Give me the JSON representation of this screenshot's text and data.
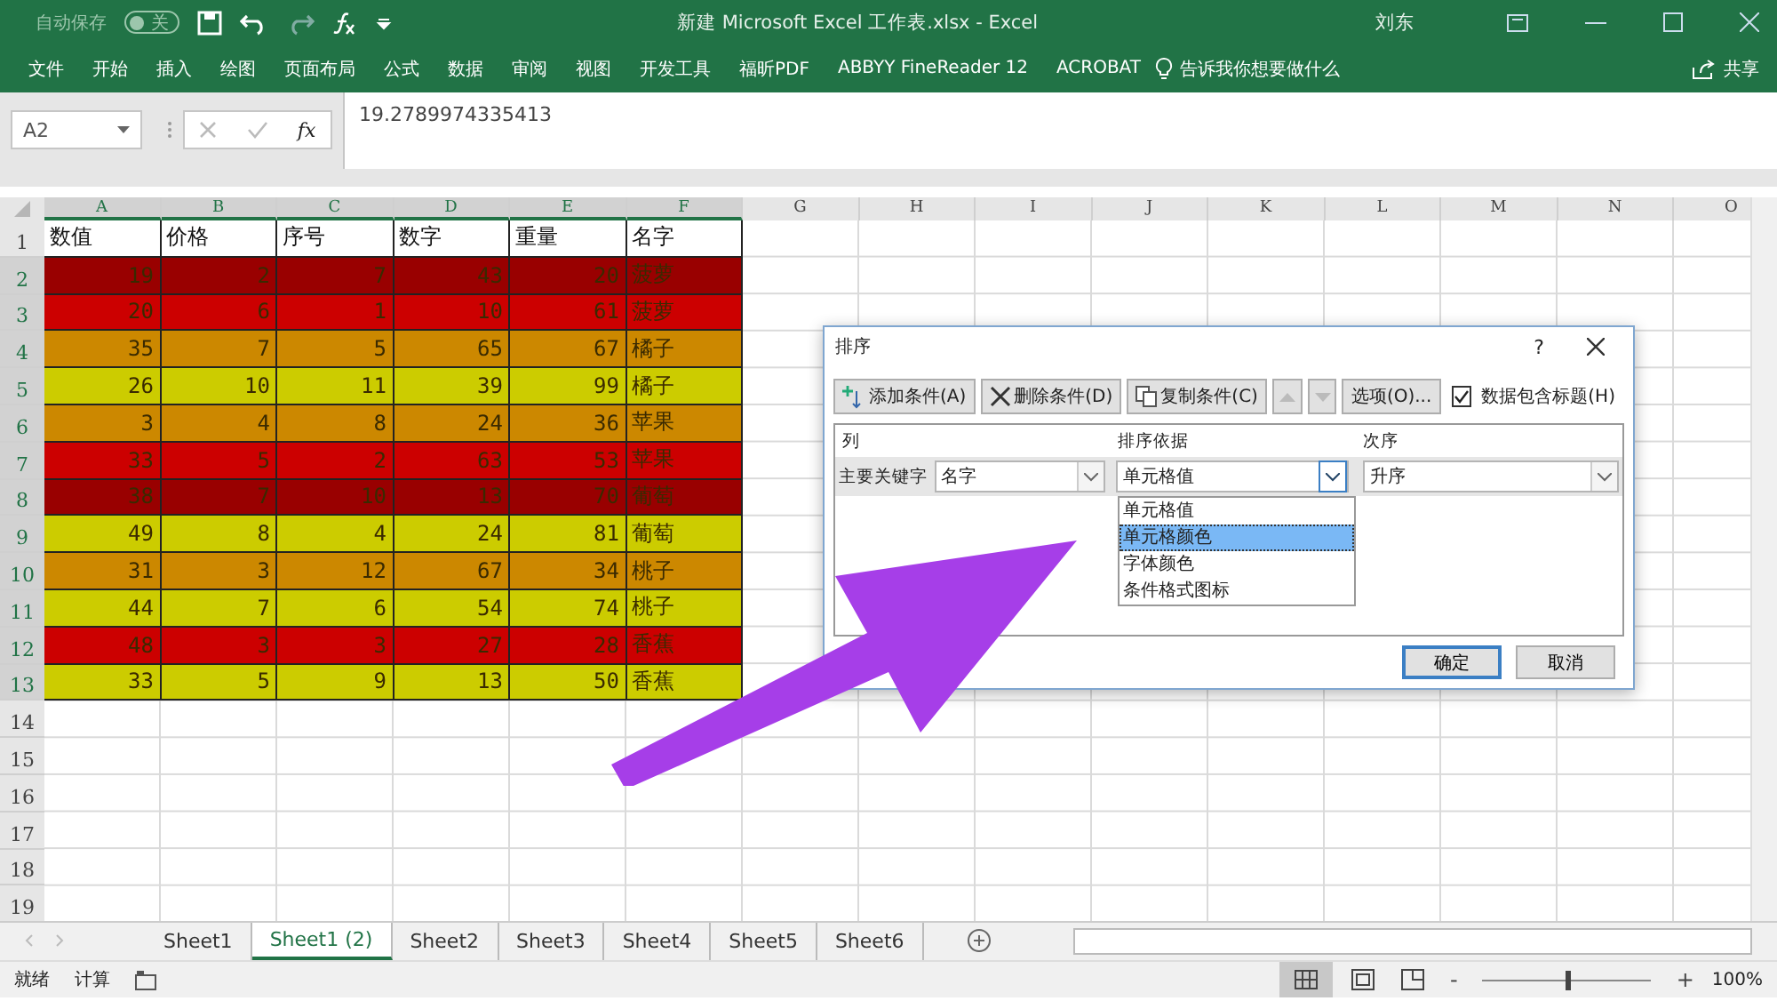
{
  "title_bar": {
    "autosave_label": "自动保存",
    "autosave_state": "关",
    "autosave_on": false,
    "title": "新建 Microsoft Excel 工作表.xlsx  -  Excel",
    "user": "刘东"
  },
  "ribbon": {
    "tabs": [
      "文件",
      "开始",
      "插入",
      "绘图",
      "页面布局",
      "公式",
      "数据",
      "审阅",
      "视图",
      "开发工具",
      "福昕PDF",
      "ABBYY FineReader 12",
      "ACROBAT"
    ],
    "tell_me": "告诉我你想要做什么",
    "share": "共享"
  },
  "formula_bar": {
    "name_box": "A2",
    "fx": "fx",
    "value": "19.2789974335413"
  },
  "sheet": {
    "columns": [
      "A",
      "B",
      "C",
      "D",
      "E",
      "F",
      "G",
      "H",
      "I",
      "J",
      "K",
      "L",
      "M",
      "N",
      "O"
    ],
    "row_numbers": [
      "1",
      "2",
      "3",
      "4",
      "5",
      "6",
      "7",
      "8",
      "9",
      "10",
      "11",
      "12",
      "13",
      "14",
      "15",
      "16",
      "17",
      "18",
      "19"
    ],
    "header": [
      "数值",
      "价格",
      "序号",
      "数字",
      "重量",
      "名字"
    ],
    "rows": [
      {
        "color": "#990000",
        "cells": [
          "19",
          "2",
          "7",
          "43",
          "20",
          "菠萝"
        ]
      },
      {
        "color": "#cc0000",
        "cells": [
          "20",
          "6",
          "1",
          "10",
          "61",
          "菠萝"
        ]
      },
      {
        "color": "#cc8800",
        "cells": [
          "35",
          "7",
          "5",
          "65",
          "67",
          "橘子"
        ]
      },
      {
        "color": "#cccc00",
        "cells": [
          "26",
          "10",
          "11",
          "39",
          "99",
          "橘子"
        ]
      },
      {
        "color": "#cc8800",
        "cells": [
          "3",
          "4",
          "8",
          "24",
          "36",
          "苹果"
        ]
      },
      {
        "color": "#cc0000",
        "cells": [
          "33",
          "5",
          "2",
          "63",
          "53",
          "苹果"
        ]
      },
      {
        "color": "#990000",
        "cells": [
          "38",
          "7",
          "10",
          "13",
          "70",
          "葡萄"
        ]
      },
      {
        "color": "#cccc00",
        "cells": [
          "49",
          "8",
          "4",
          "24",
          "81",
          "葡萄"
        ]
      },
      {
        "color": "#cc8800",
        "cells": [
          "31",
          "3",
          "12",
          "67",
          "34",
          "桃子"
        ]
      },
      {
        "color": "#cccc00",
        "cells": [
          "44",
          "7",
          "6",
          "54",
          "74",
          "桃子"
        ]
      },
      {
        "color": "#cc0000",
        "cells": [
          "48",
          "3",
          "3",
          "27",
          "28",
          "香蕉"
        ]
      },
      {
        "color": "#cccc00",
        "cells": [
          "33",
          "5",
          "9",
          "13",
          "50",
          "香蕉"
        ]
      }
    ]
  },
  "dialog": {
    "title": "排序",
    "help": "?",
    "toolbar": [
      "添加条件(A)",
      "删除条件(D)",
      "复制条件(C)",
      "选项(O)..."
    ],
    "has_headers_label": "数据包含标题(H)",
    "has_headers_checked": true,
    "column_headings": [
      "列",
      "排序依据",
      "次序"
    ],
    "key_label": "主要关键字",
    "column_value": "名字",
    "sort_on_value": "单元格值",
    "order_value": "升序",
    "sort_on_options": [
      {
        "label": "单元格值",
        "selected": false
      },
      {
        "label": "单元格颜色",
        "selected": true
      },
      {
        "label": "字体颜色",
        "selected": false
      },
      {
        "label": "条件格式图标",
        "selected": false
      }
    ],
    "ok": "确定",
    "cancel": "取消"
  },
  "sheet_tabs": [
    {
      "label": "Sheet1",
      "selected": false
    },
    {
      "label": "Sheet1 (2)",
      "selected": true
    },
    {
      "label": "Sheet2",
      "selected": false
    },
    {
      "label": "Sheet3",
      "selected": false
    },
    {
      "label": "Sheet4",
      "selected": false
    },
    {
      "label": "Sheet5",
      "selected": false
    },
    {
      "label": "Sheet6",
      "selected": false
    }
  ],
  "status_bar": {
    "ready": "就绪",
    "calc": "计算",
    "zoom": "100%",
    "zoom_out": "-",
    "zoom_in": "+",
    "zoom_slider": {
      "level": 0.5
    }
  }
}
